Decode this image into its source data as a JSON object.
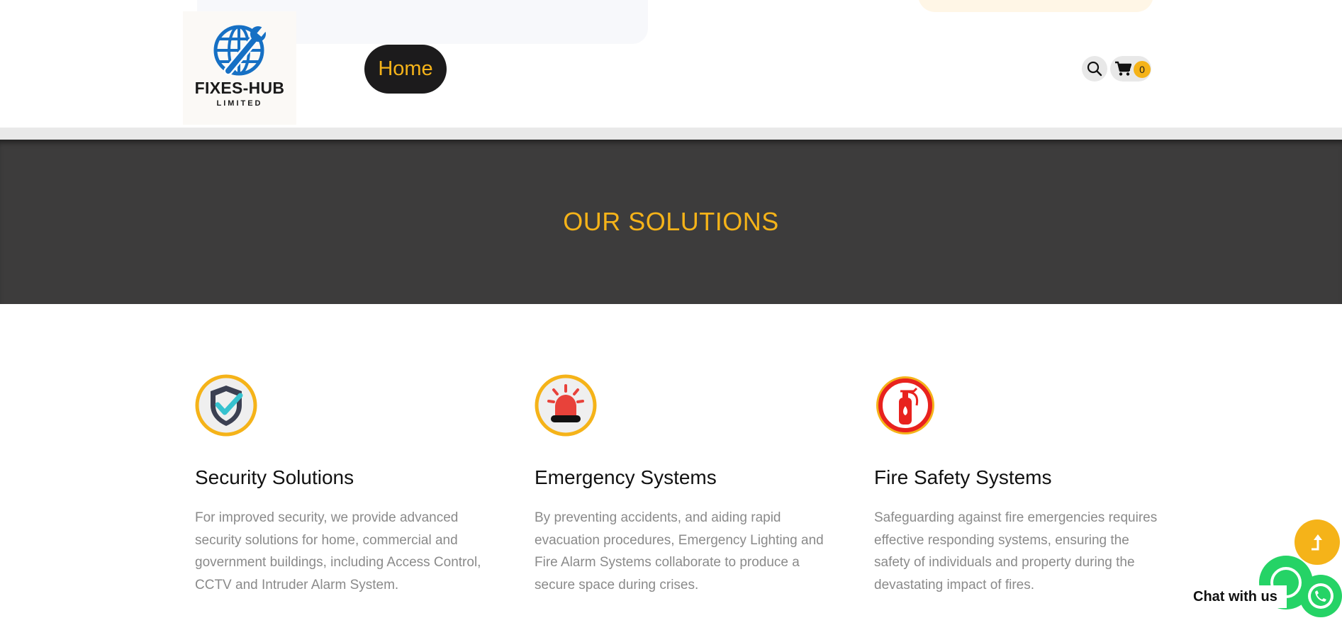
{
  "header": {
    "logo": {
      "title": "FIXES-HUB",
      "subtitle": "LIMITED",
      "icon": "globe-wrench-icon"
    },
    "nav": {
      "home_label": "Home"
    },
    "search": {
      "icon": "search-icon"
    },
    "cart": {
      "icon": "cart-icon",
      "count": "0"
    }
  },
  "hero": {
    "title": "OUR SOLUTIONS"
  },
  "solutions": [
    {
      "icon": "shield-check-icon",
      "title": "Security Solutions",
      "description": "For improved security, we provide advanced security solutions for home, commercial and government buildings, including Access Control, CCTV and Intruder Alarm System."
    },
    {
      "icon": "alarm-siren-icon",
      "title": "Emergency Systems",
      "description": "By preventing accidents, and aiding rapid evacuation procedures, Emergency Lighting and Fire Alarm Systems collaborate to produce a secure space during crises."
    },
    {
      "icon": "fire-extinguisher-icon",
      "title": "Fire Safety Systems",
      "description": "Safeguarding against fire emergencies requires effective responding systems, ensuring the safety of individuals and property during the devastating impact of fires."
    }
  ],
  "floating": {
    "back_to_top_icon": "arrow-up-icon",
    "chat_label": "Chat with us",
    "whatsapp_icon": "whatsapp-icon"
  },
  "colors": {
    "accent": "#f5b319",
    "dark": "#3d3c3c",
    "nav_bg": "#1c1b1c",
    "whatsapp": "#25d366"
  }
}
